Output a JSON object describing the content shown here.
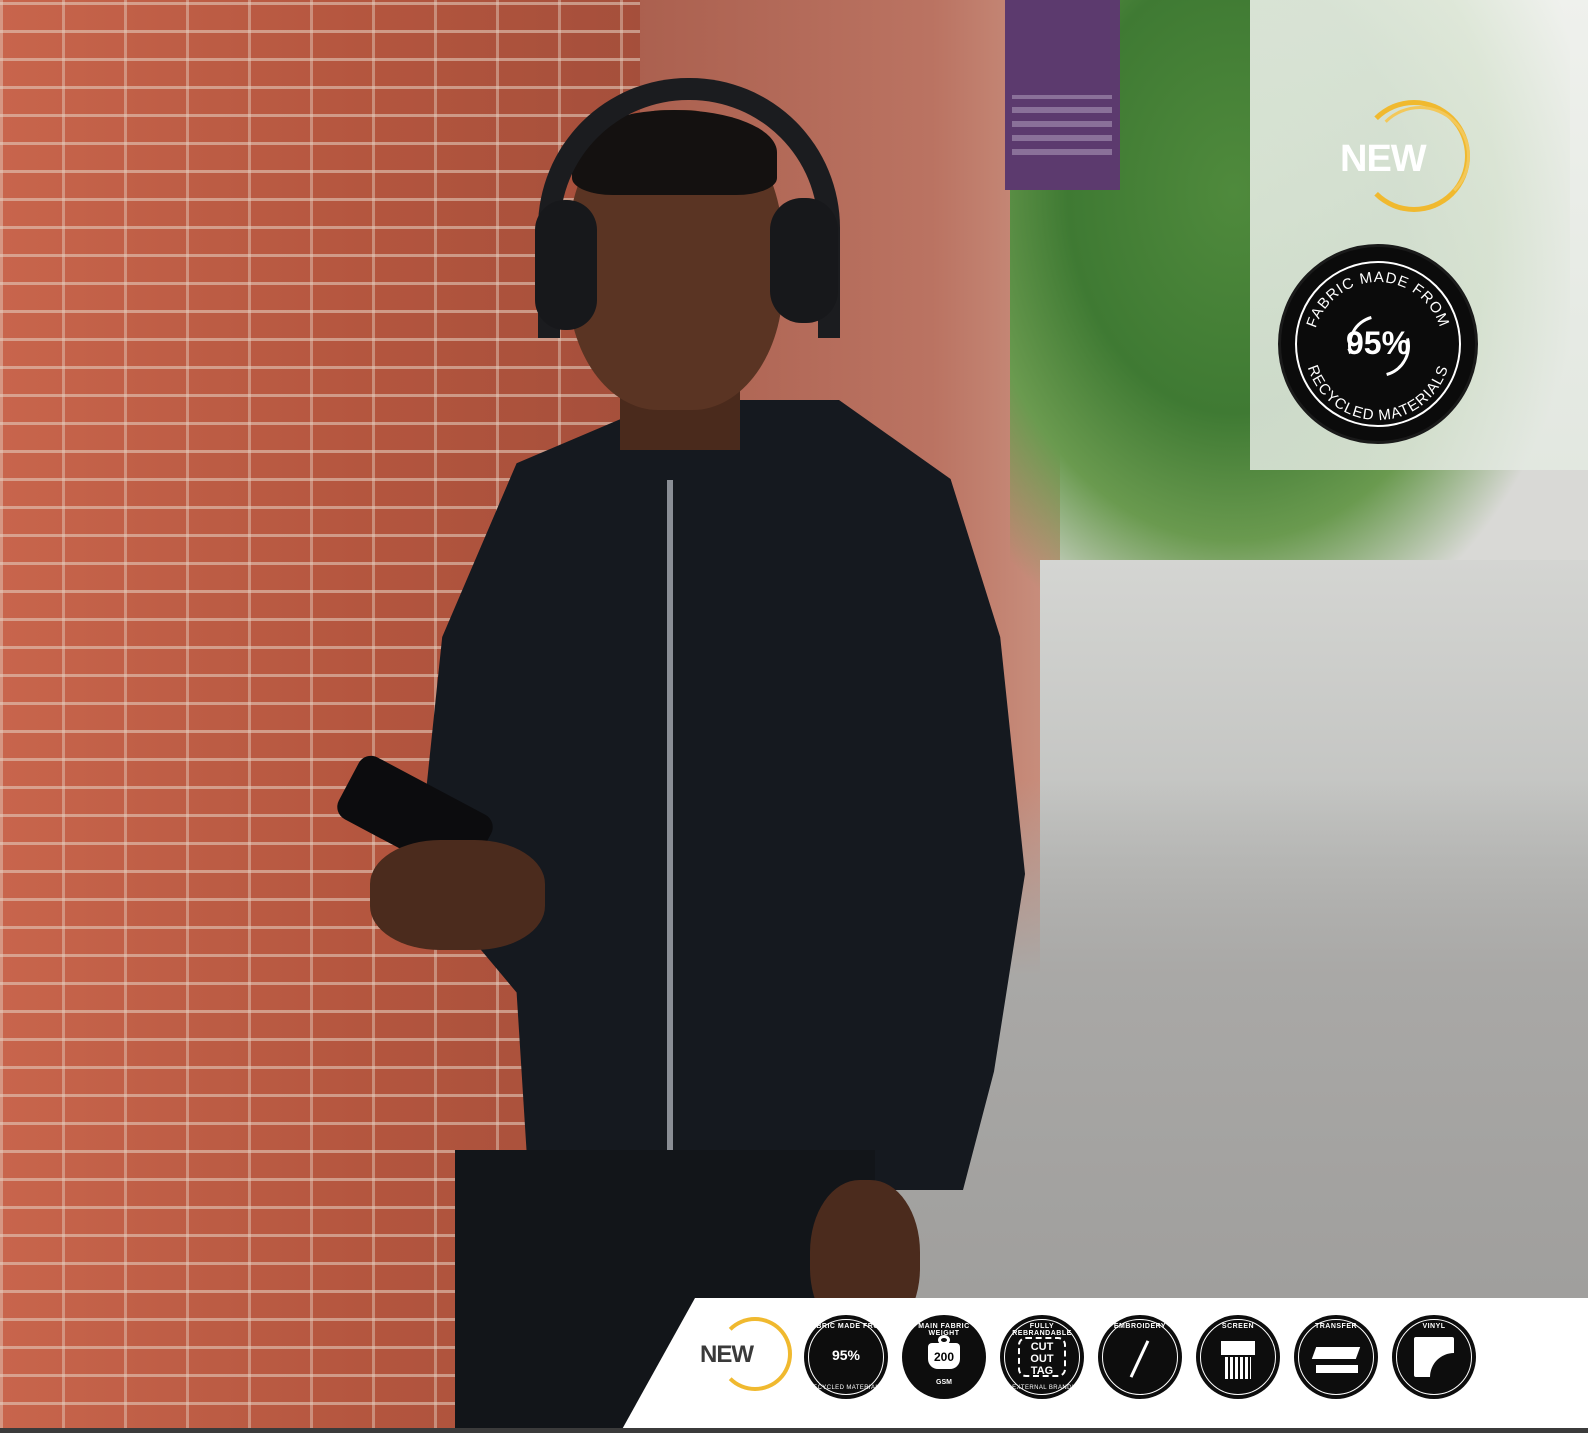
{
  "badges": {
    "new_label": "NEW",
    "recycled": {
      "top_text": "FABRIC MADE FROM",
      "percent": "95%",
      "bottom_text": "RECYCLED MATERIALS"
    },
    "accent_gold": "#f0b92f"
  },
  "feature_icons": [
    {
      "id": "new",
      "label": "NEW",
      "icon": "new-icon"
    },
    {
      "id": "recycled",
      "top": "FABRIC MADE FROM",
      "center": "95%",
      "bottom": "RECYCLED MATERIALS",
      "icon": "recycled-icon"
    },
    {
      "id": "weight",
      "top": "MAIN FABRIC WEIGHT",
      "center": "200",
      "bottom": "GSM",
      "icon": "weight-icon"
    },
    {
      "id": "cut-tag",
      "top": "FULLY REBRANDABLE",
      "center": "CUT OUT TAG",
      "bottom": "NO EXTERNAL BRANDING",
      "icon": "scissors-icon"
    },
    {
      "id": "embroidery",
      "top": "EMBROIDERY",
      "icon": "needle-icon"
    },
    {
      "id": "screen",
      "top": "SCREEN",
      "icon": "screen-print-icon"
    },
    {
      "id": "transfer",
      "top": "TRANSFER",
      "icon": "heat-press-icon"
    },
    {
      "id": "vinyl",
      "top": "VINYL",
      "icon": "vinyl-icon"
    }
  ]
}
